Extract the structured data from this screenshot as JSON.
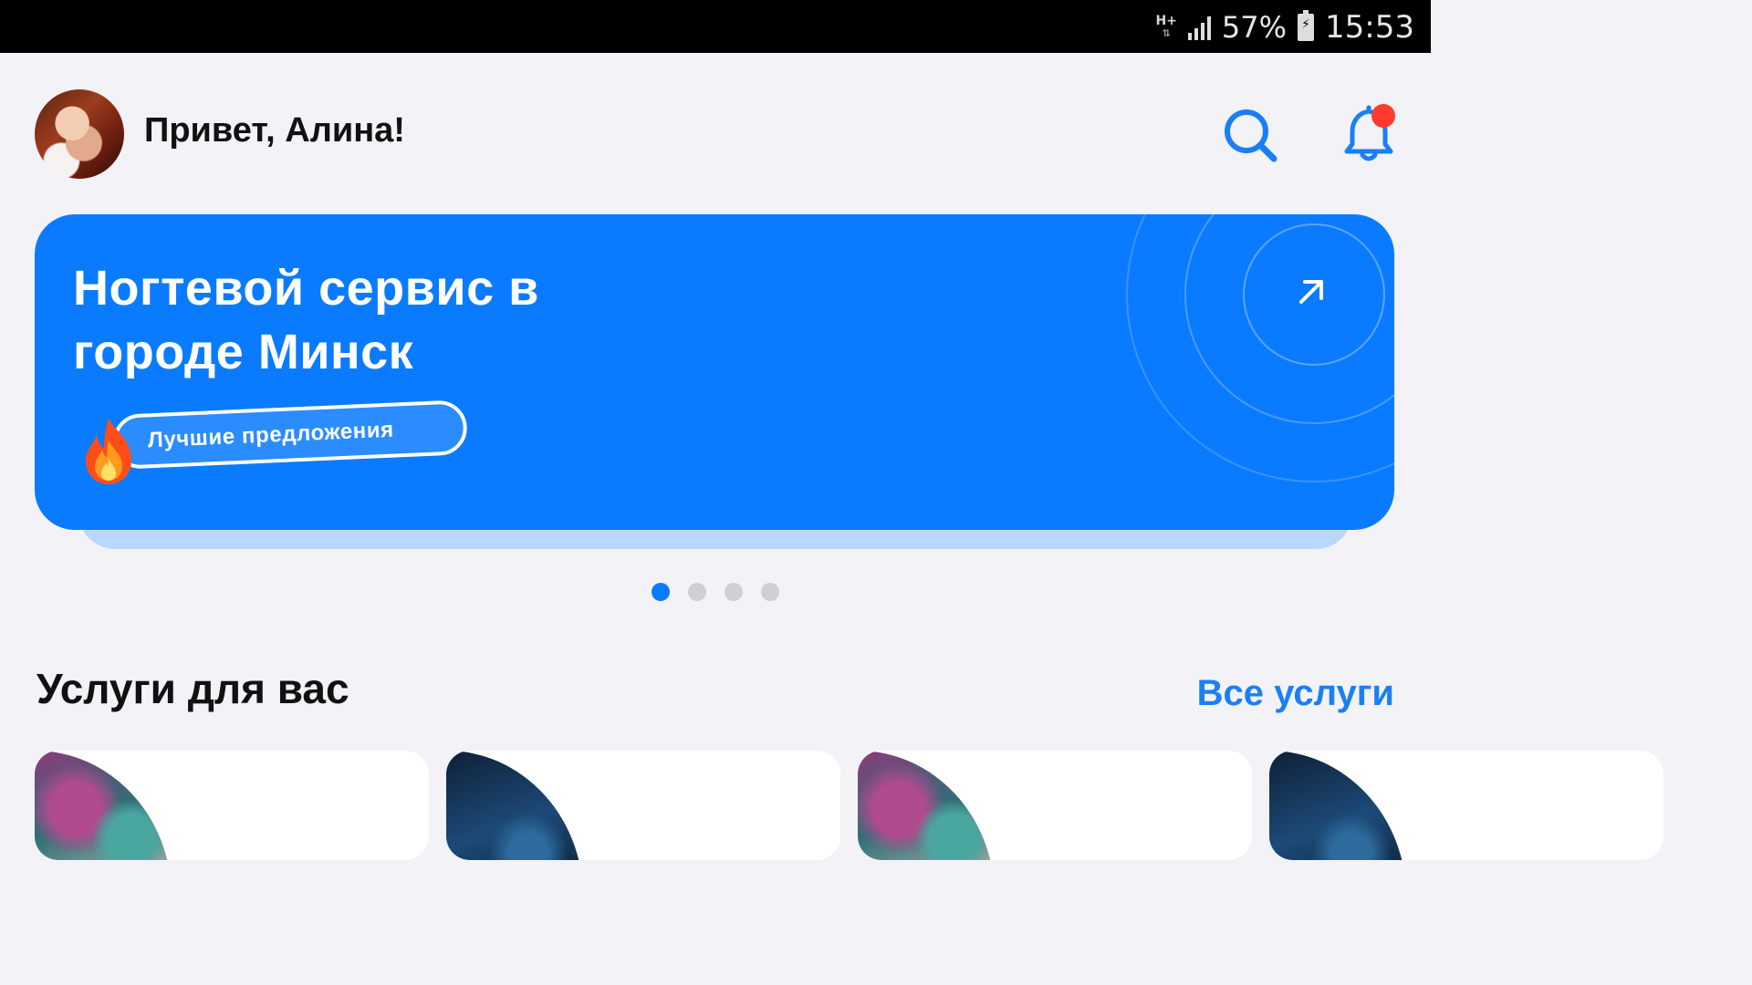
{
  "status_bar": {
    "network": "H+",
    "battery_percent": "57%",
    "time": "15:53"
  },
  "header": {
    "greeting": "Привет, Алина!",
    "has_notification": true
  },
  "banner": {
    "title": "Ногтевой сервис в городе Минск",
    "badge_label": "Лучшие предложения",
    "background_color": "#0a7bff"
  },
  "carousel": {
    "page_count": 4,
    "active_index": 0
  },
  "services": {
    "title": "Услуги для вас",
    "all_link": "Все услуги",
    "cards": [
      {
        "image": "hair-image-pink"
      },
      {
        "image": "hair-image-blue"
      },
      {
        "image": "hair-image-pink"
      },
      {
        "image": "hair-image-blue"
      }
    ]
  },
  "colors": {
    "accent": "#1a7ff5",
    "background": "#f2f2f7",
    "notification_dot": "#ff3b30"
  }
}
